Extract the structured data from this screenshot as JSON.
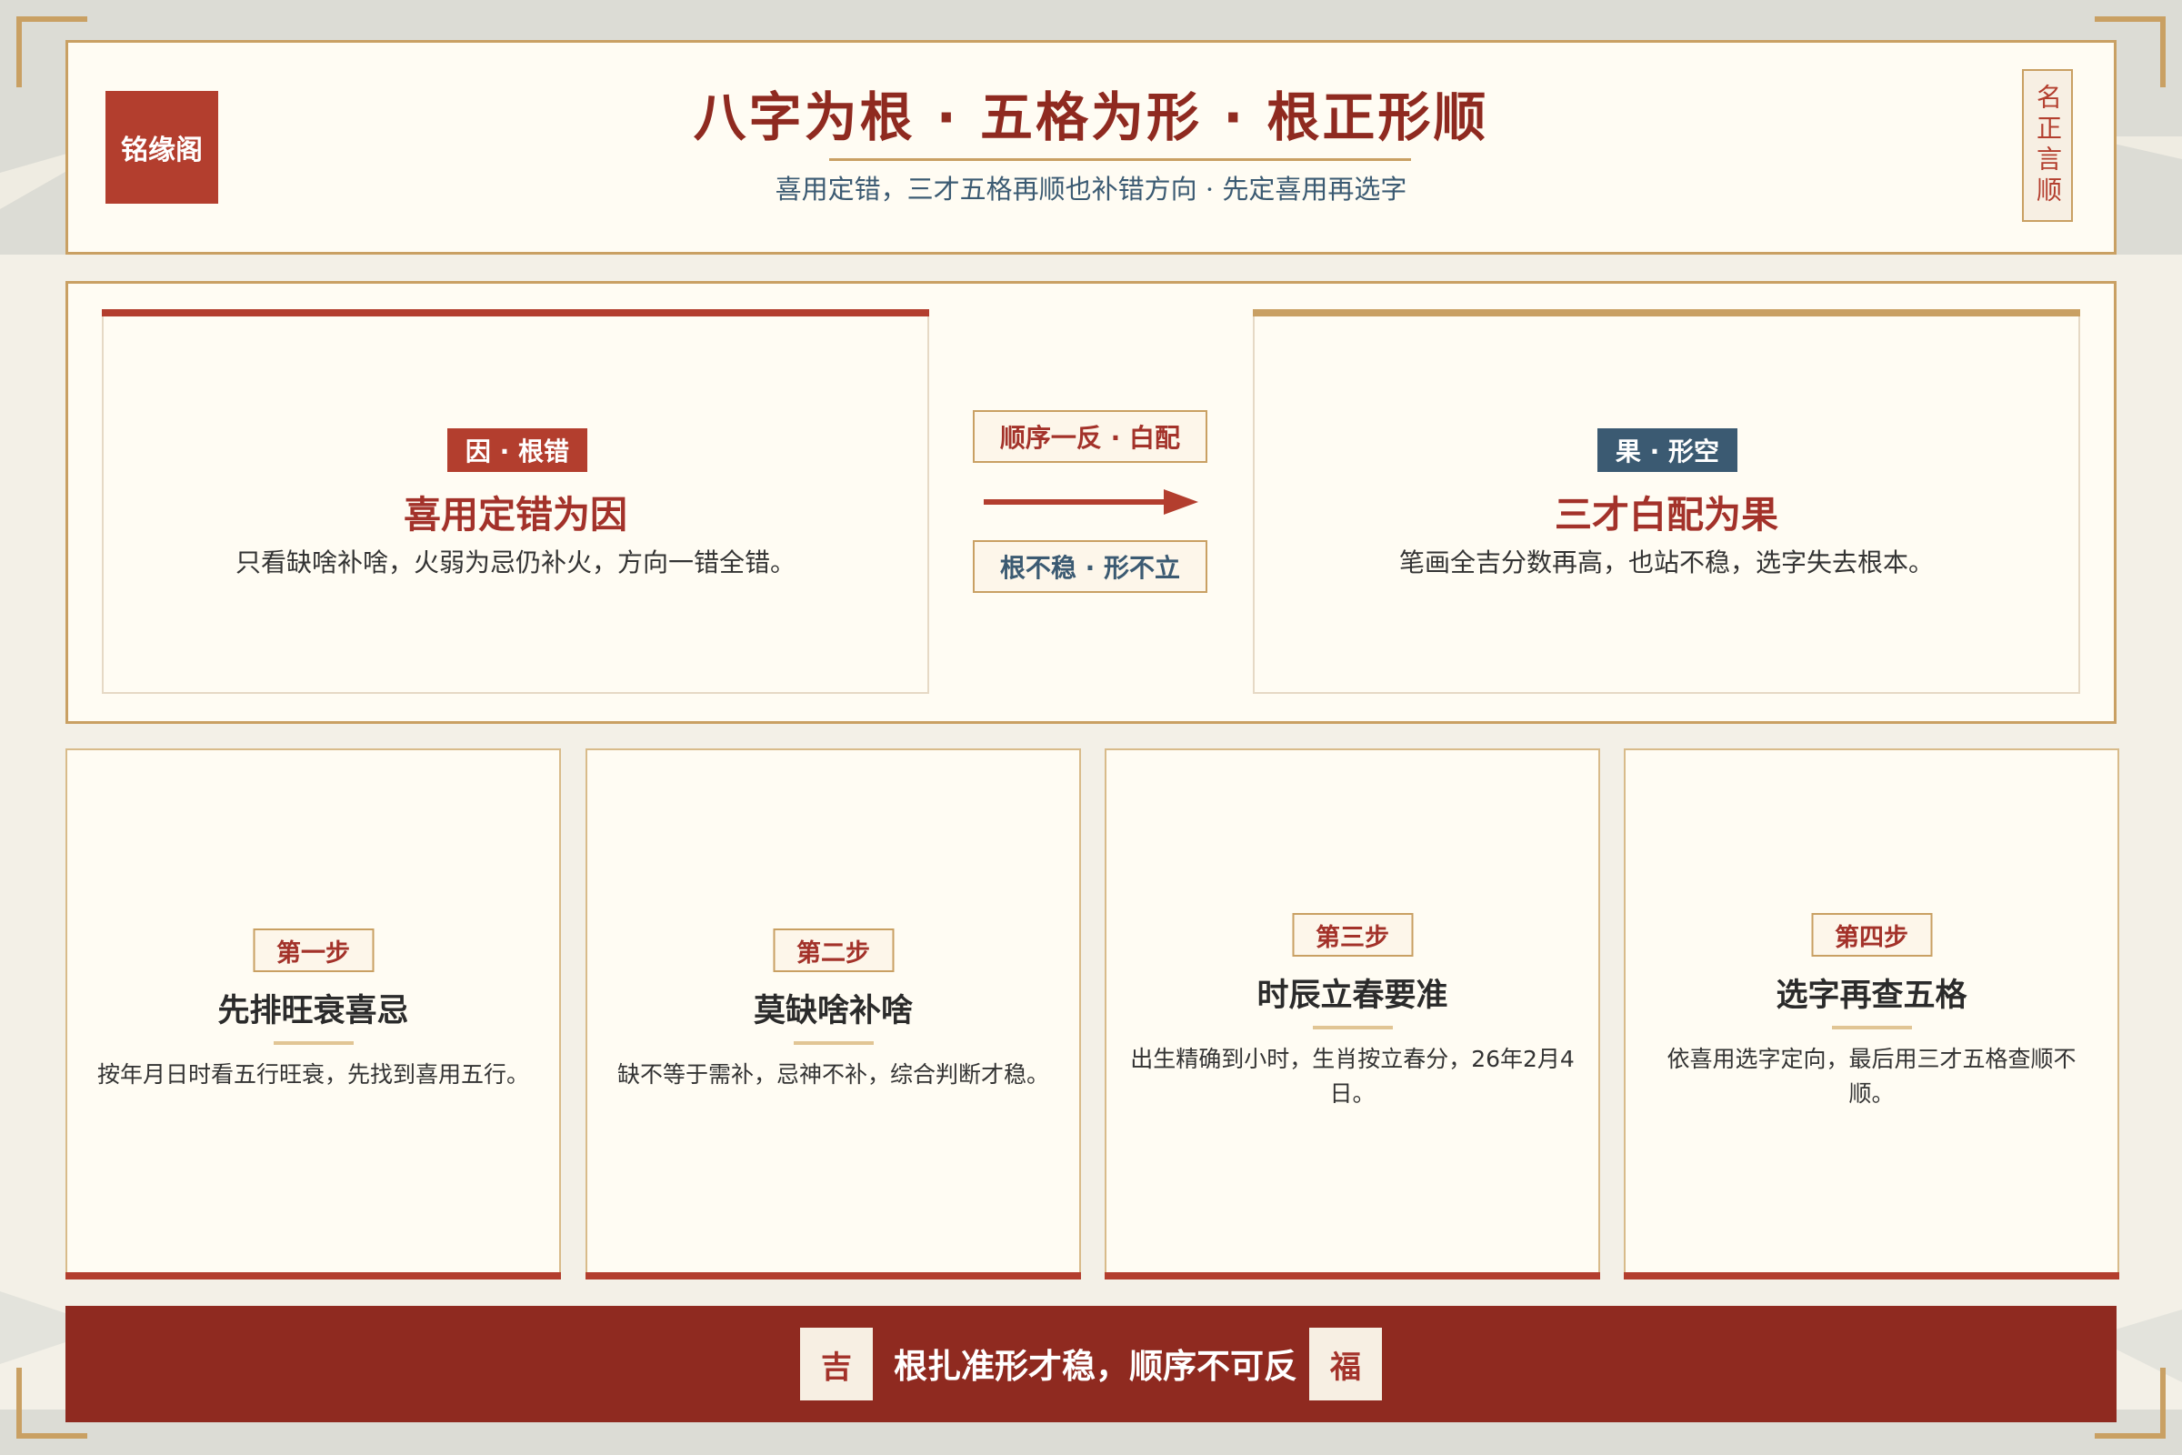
{
  "header": {
    "logo": "铭缘阁",
    "title": "八字为根 · 五格为形 · 根正形顺",
    "subtitle": "喜用定错，三才五格再顺也补错方向 · 先定喜用再选字",
    "seal": "名正言顺"
  },
  "cause": {
    "tag": "因 · 根错",
    "title": "喜用定错为因",
    "desc": "只看缺啥补啥，火弱为忌仍补火，方向一错全错。"
  },
  "middle": {
    "top": "顺序一反 · 白配",
    "bottom": "根不稳 · 形不立"
  },
  "effect": {
    "tag": "果 · 形空",
    "title": "三才白配为果",
    "desc": "笔画全吉分数再高，也站不稳，选字失去根本。"
  },
  "steps": [
    {
      "tag": "第一步",
      "title": "先排旺衰喜忌",
      "desc": "按年月日时看五行旺衰，先找到喜用五行。"
    },
    {
      "tag": "第二步",
      "title": "莫缺啥补啥",
      "desc": "缺不等于需补，忌神不补，综合判断才稳。"
    },
    {
      "tag": "第三步",
      "title": "时辰立春要准",
      "desc": "出生精确到小时，生肖按立春分，26年2月4日。"
    },
    {
      "tag": "第四步",
      "title": "选字再查五格",
      "desc": "依喜用选字定向，最后用三才五格查顺不顺。"
    }
  ],
  "footer": {
    "left_chip": "吉",
    "text": "根扎准形才稳，顺序不可反",
    "right_chip": "福"
  },
  "colors": {
    "accent_red": "#b33e2e",
    "dark_red": "#8f2a20",
    "gold": "#c9a063",
    "navy": "#3b5a72",
    "paper": "#fffcf3"
  }
}
